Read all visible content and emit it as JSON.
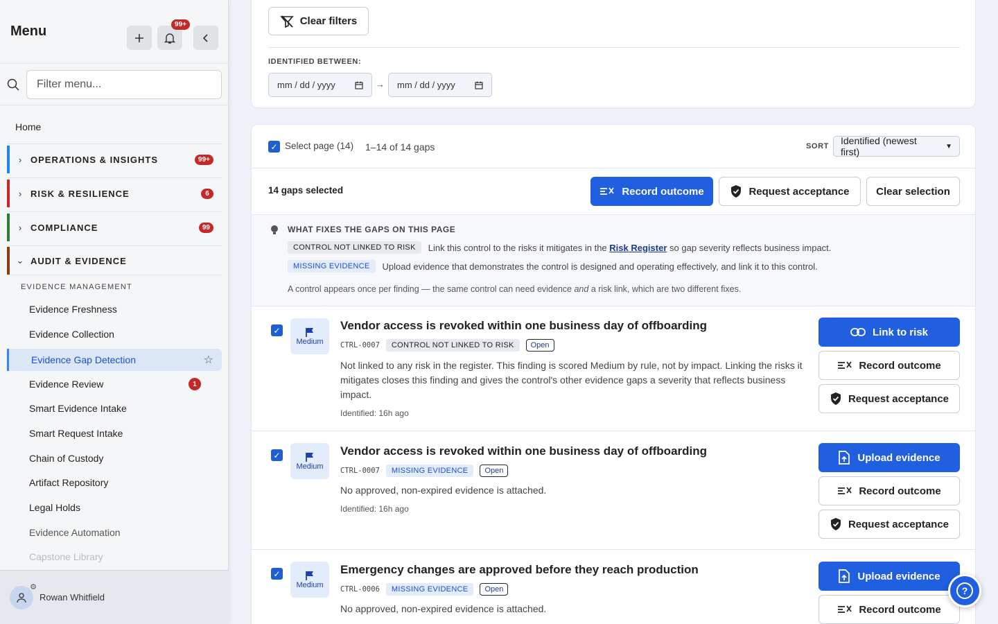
{
  "sidebar": {
    "title": "Menu",
    "notification_badge": "99+",
    "search_placeholder": "Filter menu...",
    "home": "Home",
    "sections": [
      {
        "label": "OPERATIONS & INSIGHTS",
        "badge": "99+",
        "color": "#1e88e5"
      },
      {
        "label": "RISK & RESILIENCE",
        "badge": "6",
        "color": "#c62828"
      },
      {
        "label": "COMPLIANCE",
        "badge": "99",
        "color": "#2e7d32"
      },
      {
        "label": "AUDIT & EVIDENCE",
        "badge": "",
        "color": "#8d3a1a"
      }
    ],
    "subheading": "EVIDENCE MANAGEMENT",
    "items": [
      {
        "label": "Evidence Freshness"
      },
      {
        "label": "Evidence Collection"
      },
      {
        "label": "Evidence Gap Detection",
        "active": true
      },
      {
        "label": "Evidence Review",
        "badge": "1"
      },
      {
        "label": "Smart Evidence Intake"
      },
      {
        "label": "Smart Request Intake"
      },
      {
        "label": "Chain of Custody"
      },
      {
        "label": "Artifact Repository"
      },
      {
        "label": "Legal Holds"
      },
      {
        "label": "Evidence Automation"
      },
      {
        "label": "Capstone Library"
      }
    ],
    "user": "Rowan Whitfield"
  },
  "filters": {
    "clear_label": "Clear filters",
    "identified_label": "IDENTIFIED BETWEEN:",
    "date_placeholder": "mm / dd / yyyy",
    "arrow": "→"
  },
  "list": {
    "select_page": "Select page (14)",
    "range": "1–14 of 14 gaps",
    "sort_label": "SORT",
    "sort_value": "Identified (newest first)",
    "selected_count": "14 gaps selected",
    "record_outcome": "Record outcome",
    "request_acceptance": "Request acceptance",
    "clear_selection": "Clear selection"
  },
  "hint": {
    "heading": "WHAT FIXES THE GAPS ON THIS PAGE",
    "row1_tag": "CONTROL NOT LINKED TO RISK",
    "row1_pre": "Link this control to the risks it mitigates in the",
    "row1_link": "Risk Register",
    "row1_post": "so gap severity reflects business impact.",
    "row2_tag": "MISSING EVIDENCE",
    "row2_text": "Upload evidence that demonstrates the control is designed and operating effectively, and link it to this control.",
    "note_pre": "A control appears once per finding — the same control can need evidence",
    "note_em": "and",
    "note_post": "a risk link, which are two different fixes."
  },
  "findings": [
    {
      "severity": "Medium",
      "title": "Vendor access is revoked within one business day of offboarding",
      "code": "CTRL-0007",
      "tag": "CONTROL NOT LINKED TO RISK",
      "status": "Open",
      "description": "Not linked to any risk in the register. This finding is scored Medium by rule, not by impact. Linking the risks it mitigates closes this finding and gives the control's other evidence gaps a severity that reflects business impact.",
      "identified": "Identified: 16h ago",
      "primary_action": "Link to risk",
      "secondary_action": "Record outcome",
      "tertiary_action": "Request acceptance"
    },
    {
      "severity": "Medium",
      "title": "Vendor access is revoked within one business day of offboarding",
      "code": "CTRL-0007",
      "tag": "MISSING EVIDENCE",
      "status": "Open",
      "description": "No approved, non-expired evidence is attached.",
      "identified": "Identified: 16h ago",
      "primary_action": "Upload evidence",
      "secondary_action": "Record outcome",
      "tertiary_action": "Request acceptance"
    },
    {
      "severity": "Medium",
      "title": "Emergency changes are approved before they reach production",
      "code": "CTRL-0006",
      "tag": "MISSING EVIDENCE",
      "status": "Open",
      "description": "No approved, non-expired evidence is attached.",
      "primary_action": "Upload evidence",
      "secondary_action": "Record outcome"
    }
  ],
  "help": "?"
}
